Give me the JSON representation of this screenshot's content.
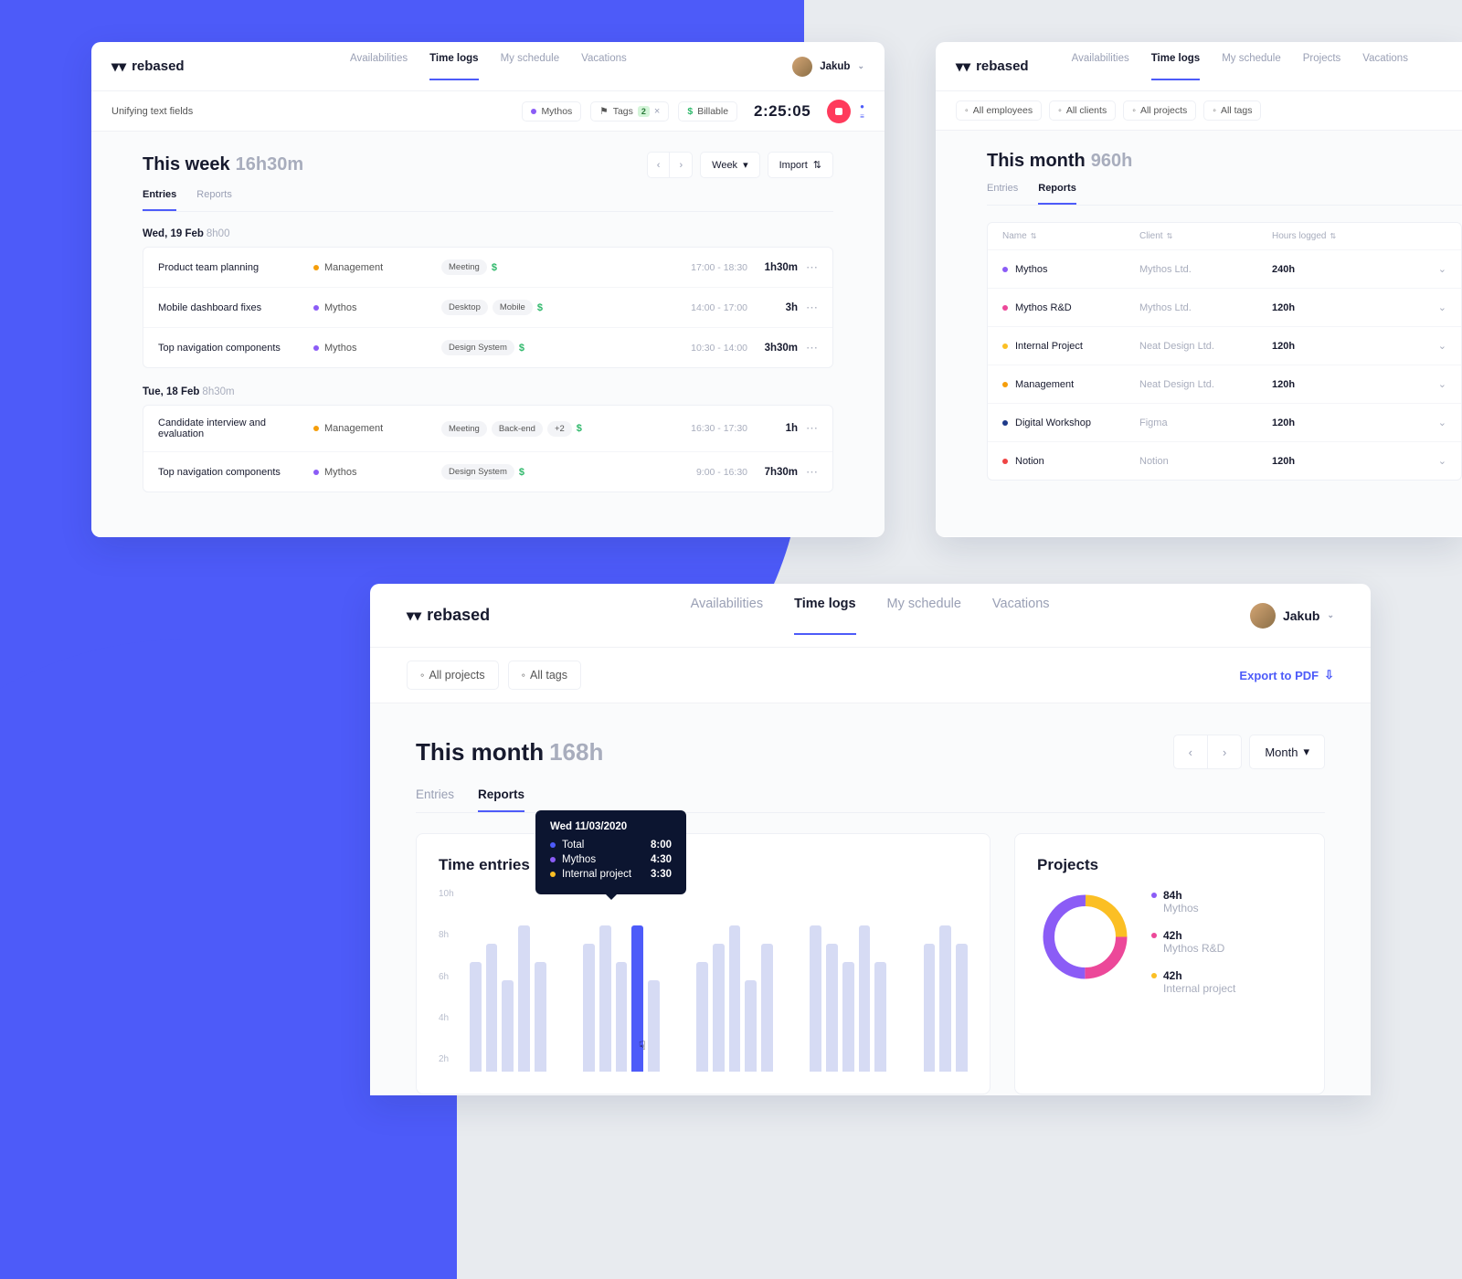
{
  "brand": "rebased",
  "nav": {
    "availabilities": "Availabilities",
    "timelogs": "Time logs",
    "schedule": "My schedule",
    "vacations": "Vacations",
    "projects": "Projects"
  },
  "user": {
    "name": "Jakub"
  },
  "cardA": {
    "task": "Unifying text fields",
    "chips": {
      "project": "Mythos",
      "tags_label": "Tags",
      "tags_count": "2",
      "billable": "Billable"
    },
    "timer": "2:25:05",
    "heading": "This week",
    "heading_hours": "16h30m",
    "controls": {
      "period": "Week",
      "import": "Import"
    },
    "tabs": {
      "entries": "Entries",
      "reports": "Reports"
    },
    "days": [
      {
        "label": "Wed, 19 Feb",
        "hours": "8h00",
        "entries": [
          {
            "name": "Product team planning",
            "proj": "Management",
            "proj_color": "c-orange",
            "tags": [
              "Meeting"
            ],
            "billable": true,
            "time": "17:00 - 18:30",
            "dur": "1h30m"
          },
          {
            "name": "Mobile dashboard fixes",
            "proj": "Mythos",
            "proj_color": "c-purple",
            "tags": [
              "Desktop",
              "Mobile"
            ],
            "billable": true,
            "time": "14:00 - 17:00",
            "dur": "3h"
          },
          {
            "name": "Top navigation components",
            "proj": "Mythos",
            "proj_color": "c-purple",
            "tags": [
              "Design System"
            ],
            "billable": true,
            "time": "10:30 - 14:00",
            "dur": "3h30m"
          }
        ]
      },
      {
        "label": "Tue, 18 Feb",
        "hours": "8h30m",
        "entries": [
          {
            "name": "Candidate interview and evaluation",
            "proj": "Management",
            "proj_color": "c-orange",
            "tags": [
              "Meeting",
              "Back-end"
            ],
            "more": "+2",
            "billable": true,
            "time": "16:30 - 17:30",
            "dur": "1h"
          },
          {
            "name": "Top navigation components",
            "proj": "Mythos",
            "proj_color": "c-purple",
            "tags": [
              "Design System"
            ],
            "billable": true,
            "time": "9:00 - 16:30",
            "dur": "7h30m"
          }
        ]
      }
    ]
  },
  "cardB": {
    "filters": {
      "employees": "All employees",
      "clients": "All clients",
      "projects": "All projects",
      "tags": "All tags"
    },
    "heading": "This month",
    "heading_hours": "960h",
    "columns": {
      "name": "Name",
      "client": "Client",
      "hours": "Hours logged"
    },
    "rows": [
      {
        "name": "Mythos",
        "color": "c-purple",
        "client": "Mythos Ltd.",
        "hours": "240h"
      },
      {
        "name": "Mythos R&D",
        "color": "c-pink",
        "client": "Mythos Ltd.",
        "hours": "120h"
      },
      {
        "name": "Internal Project",
        "color": "c-yellow",
        "client": "Neat Design Ltd.",
        "hours": "120h"
      },
      {
        "name": "Management",
        "color": "c-orange",
        "client": "Neat Design Ltd.",
        "hours": "120h"
      },
      {
        "name": "Digital Workshop",
        "color": "c-navy",
        "client": "Figma",
        "hours": "120h"
      },
      {
        "name": "Notion",
        "color": "c-red",
        "client": "Notion",
        "hours": "120h"
      }
    ]
  },
  "cardC": {
    "filters": {
      "projects": "All projects",
      "tags": "All tags"
    },
    "export": "Export to PDF",
    "heading": "This month",
    "heading_hours": "168h",
    "period": "Month",
    "panels": {
      "entries": "Time entries",
      "projects": "Projects"
    },
    "tooltip": {
      "date": "Wed 11/03/2020",
      "rows": [
        {
          "label": "Total",
          "val": "8:00",
          "color": "c-blue"
        },
        {
          "label": "Mythos",
          "val": "4:30",
          "color": "c-purple"
        },
        {
          "label": "Internal project",
          "val": "3:30",
          "color": "c-yellow"
        }
      ]
    },
    "legend": [
      {
        "val": "84h",
        "label": "Mythos",
        "color": "c-purple"
      },
      {
        "val": "42h",
        "label": "Mythos R&D",
        "color": "c-pink"
      },
      {
        "val": "42h",
        "label": "Internal project",
        "color": "c-yellow"
      }
    ]
  },
  "chart_data": {
    "type": "bar",
    "title": "Time entries",
    "ylabel": "hours",
    "ylim": [
      0,
      10
    ],
    "yticks": [
      "10h",
      "8h",
      "6h",
      "4h",
      "2h"
    ],
    "values": [
      6,
      7,
      5,
      8,
      6,
      0,
      0,
      7,
      8,
      6,
      8,
      5,
      0,
      0,
      6,
      7,
      8,
      5,
      7,
      0,
      0,
      8,
      7,
      6,
      8,
      6,
      0,
      0,
      7,
      8,
      7
    ],
    "highlight_index": 10,
    "donut": {
      "type": "pie",
      "series": [
        {
          "name": "Mythos",
          "value": 84,
          "color": "#8b5cf6"
        },
        {
          "name": "Mythos R&D",
          "value": 42,
          "color": "#ec4899"
        },
        {
          "name": "Internal project",
          "value": 42,
          "color": "#fbbf24"
        }
      ]
    }
  }
}
